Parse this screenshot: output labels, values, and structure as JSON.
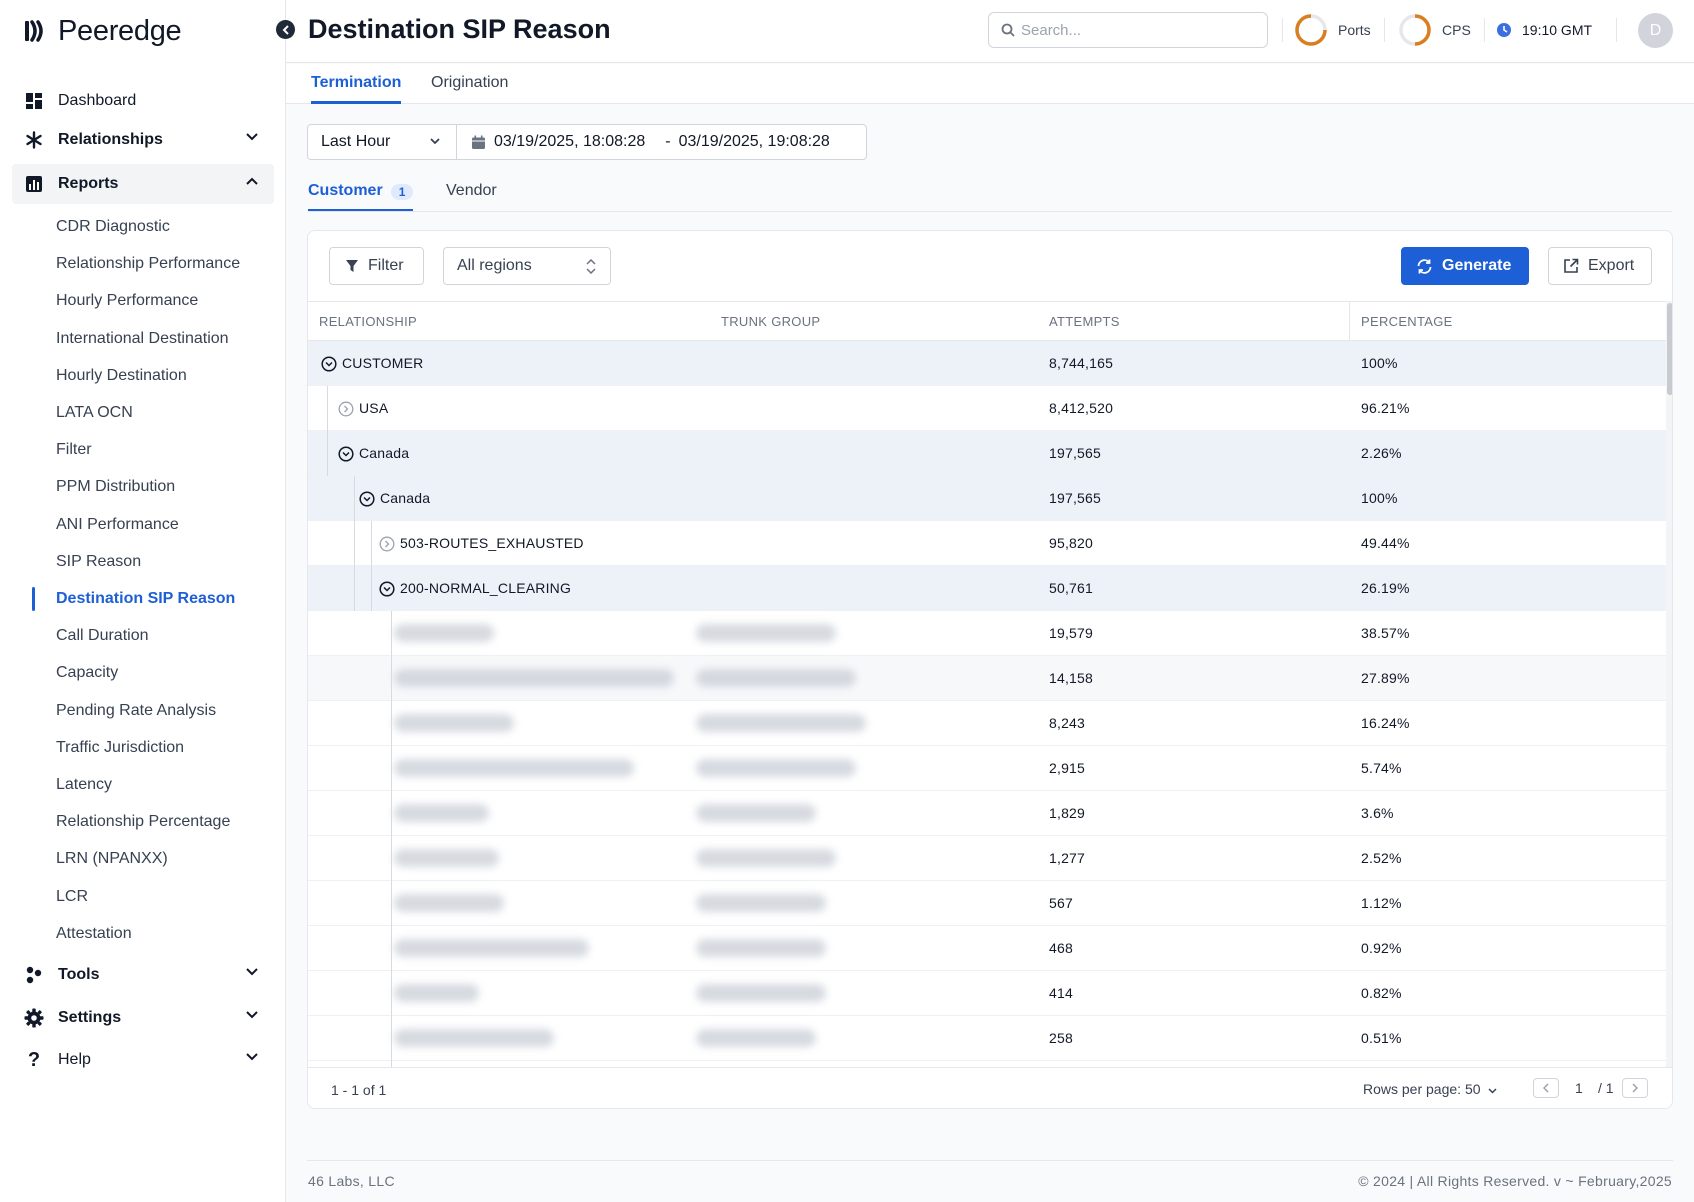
{
  "brand": {
    "name": "Peeredge"
  },
  "sidebar": {
    "top": [
      {
        "label": "Dashboard"
      },
      {
        "label": "Relationships"
      },
      {
        "label": "Reports"
      },
      {
        "label": "Tools"
      },
      {
        "label": "Settings"
      },
      {
        "label": "Help"
      }
    ],
    "reports_items": [
      "CDR Diagnostic",
      "Relationship Performance",
      "Hourly Performance",
      "International Destination",
      "Hourly Destination",
      "LATA OCN",
      "Filter",
      "PPM Distribution",
      "ANI Performance",
      "SIP Reason",
      "Destination SIP Reason",
      "Call Duration",
      "Capacity",
      "Pending Rate Analysis",
      "Traffic Jurisdiction",
      "Latency",
      "Relationship Percentage",
      "LRN (NPANXX)",
      "LCR",
      "Attestation"
    ],
    "active_item": "Destination SIP Reason"
  },
  "header": {
    "title": "Destination SIP Reason",
    "search_placeholder": "Search...",
    "ports_label": "Ports",
    "cps_label": "CPS",
    "time": "19:10 GMT",
    "avatar_initial": "D"
  },
  "tabs": {
    "termination": "Termination",
    "origination": "Origination",
    "active": "Termination"
  },
  "range": {
    "preset": "Last Hour",
    "start": "03/19/2025, 18:08:28",
    "separator": "-",
    "end": "03/19/2025, 19:08:28"
  },
  "subtabs": {
    "customer": "Customer",
    "customer_count": "1",
    "vendor": "Vendor"
  },
  "toolbar": {
    "filter": "Filter",
    "regions": "All regions",
    "generate": "Generate",
    "export": "Export"
  },
  "table": {
    "columns": [
      "RELATIONSHIP",
      "TRUNK GROUP",
      "ATTEMPTS",
      "PERCENTAGE"
    ],
    "rows": [
      {
        "label": "CUSTOMER",
        "attempts": "8,744,165",
        "percentage": "100%"
      },
      {
        "label": "USA",
        "attempts": "8,412,520",
        "percentage": "96.21%"
      },
      {
        "label": "Canada",
        "attempts": "197,565",
        "percentage": "2.26%"
      },
      {
        "label": "Canada",
        "attempts": "197,565",
        "percentage": "100%"
      },
      {
        "label": "503-ROUTES_EXHAUSTED",
        "attempts": "95,820",
        "percentage": "49.44%"
      },
      {
        "label": "200-NORMAL_CLEARING",
        "attempts": "50,761",
        "percentage": "26.19%"
      },
      {
        "label": "",
        "attempts": "19,579",
        "percentage": "38.57%"
      },
      {
        "label": "",
        "attempts": "14,158",
        "percentage": "27.89%"
      },
      {
        "label": "",
        "attempts": "8,243",
        "percentage": "16.24%"
      },
      {
        "label": "",
        "attempts": "2,915",
        "percentage": "5.74%"
      },
      {
        "label": "",
        "attempts": "1,829",
        "percentage": "3.6%"
      },
      {
        "label": "",
        "attempts": "1,277",
        "percentage": "2.52%"
      },
      {
        "label": "",
        "attempts": "567",
        "percentage": "1.12%"
      },
      {
        "label": "",
        "attempts": "468",
        "percentage": "0.92%"
      },
      {
        "label": "",
        "attempts": "414",
        "percentage": "0.82%"
      },
      {
        "label": "",
        "attempts": "258",
        "percentage": "0.51%"
      }
    ],
    "summary": "1 - 1 of 1",
    "rows_per_page": "Rows per page: 50",
    "page": "1",
    "page_total": "/ 1"
  },
  "footer": {
    "left": "46 Labs, LLC",
    "right": "© 2024 | All Rights Reserved. v ~ February,2025"
  },
  "colors": {
    "accent": "#1d5fd6",
    "row_highlight": "#edf1f8",
    "gauge": "#d97f1f"
  }
}
